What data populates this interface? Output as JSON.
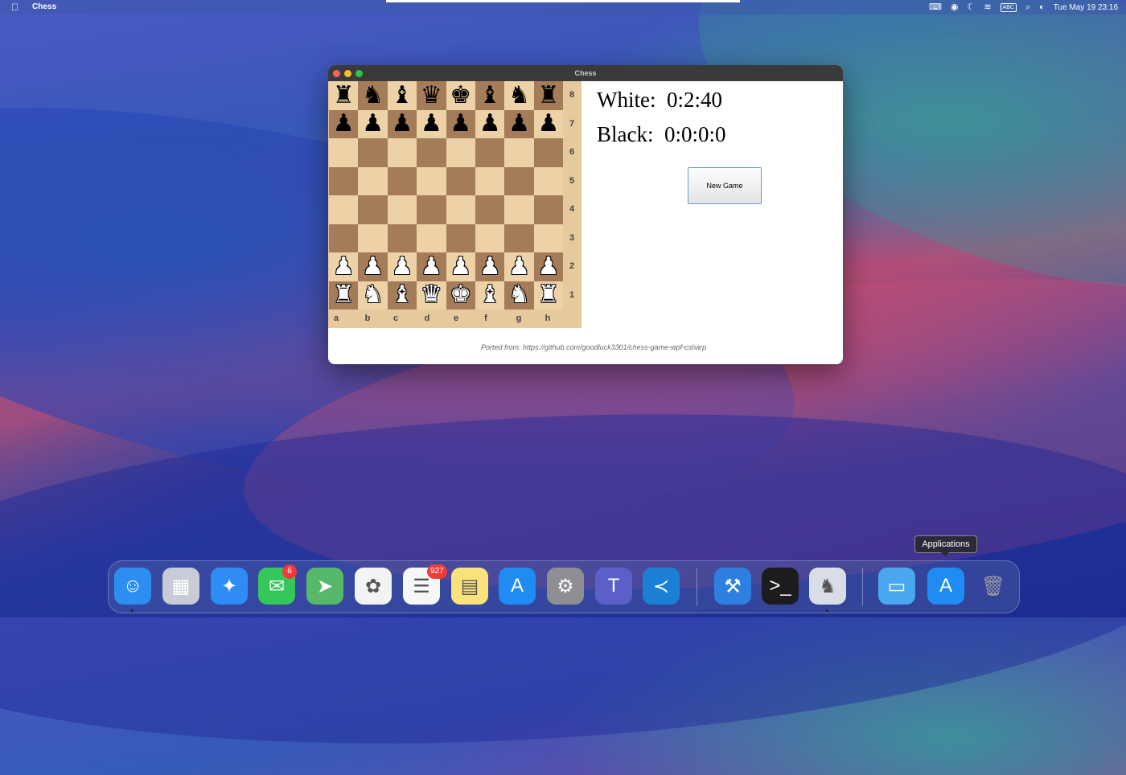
{
  "menubar": {
    "app_name": "Chess",
    "datetime": "Tue May 19  23:16",
    "status_icons": [
      "text-input-icon",
      "account-icon",
      "moon-icon",
      "wifi-icon",
      "keyboard-icon",
      "search-icon",
      "control-center-icon"
    ],
    "keyboard_label": "ABC"
  },
  "window": {
    "title": "Chess",
    "board": {
      "ranks": [
        "8",
        "7",
        "6",
        "5",
        "4",
        "3",
        "2",
        "1"
      ],
      "files": [
        "a",
        "b",
        "c",
        "d",
        "e",
        "f",
        "g",
        "h"
      ],
      "rows": [
        [
          "r",
          "n",
          "b",
          "q",
          "k",
          "b",
          "n",
          "r"
        ],
        [
          "p",
          "p",
          "p",
          "p",
          "p",
          "p",
          "p",
          "p"
        ],
        [
          "",
          "",
          "",
          "",
          "",
          "",
          "",
          ""
        ],
        [
          "",
          "",
          "",
          "",
          "",
          "",
          "",
          ""
        ],
        [
          "",
          "",
          "",
          "",
          "",
          "",
          "",
          ""
        ],
        [
          "",
          "",
          "",
          "",
          "",
          "",
          "",
          ""
        ],
        [
          "P",
          "P",
          "P",
          "P",
          "P",
          "P",
          "P",
          "P"
        ],
        [
          "R",
          "N",
          "B",
          "Q",
          "K",
          "B",
          "N",
          "R"
        ]
      ],
      "light_color": "#ecd2a6",
      "dark_color": "#a57c59"
    },
    "clocks": {
      "white_label": "White:",
      "white_time": "0:2:40",
      "black_label": "Black:",
      "black_time": "0:0:0:0"
    },
    "new_game_label": "New Game",
    "footer": "Ported from: https://github.com/goodluck3301/chess-game-wpf-csharp"
  },
  "dock": {
    "tooltip": "Applications",
    "items": [
      {
        "name": "finder",
        "color": "#2b8ef0",
        "glyph": "☺",
        "running": true
      },
      {
        "name": "launchpad",
        "color": "#c9ccd6",
        "glyph": "▦",
        "running": false
      },
      {
        "name": "safari",
        "color": "#2f8cf5",
        "glyph": "✦",
        "running": false
      },
      {
        "name": "messages",
        "color": "#35c759",
        "glyph": "✉",
        "running": false,
        "badge": "6"
      },
      {
        "name": "maps",
        "color": "#57b86a",
        "glyph": "➤",
        "running": false
      },
      {
        "name": "photos",
        "color": "#f3f3f3",
        "glyph": "✿",
        "running": false
      },
      {
        "name": "reminders",
        "color": "#f7f7f7",
        "glyph": "☰",
        "running": false,
        "badge": "927"
      },
      {
        "name": "notes",
        "color": "#fbe27a",
        "glyph": "▤",
        "running": false
      },
      {
        "name": "app-store",
        "color": "#1f8bf3",
        "glyph": "A",
        "running": false
      },
      {
        "name": "system-settings",
        "color": "#8e8e93",
        "glyph": "⚙",
        "running": false
      },
      {
        "name": "teams",
        "color": "#5b5fc7",
        "glyph": "T",
        "running": false
      },
      {
        "name": "vscode",
        "color": "#1b7fd4",
        "glyph": "≺",
        "running": false
      },
      {
        "name": "xcode",
        "color": "#2d7fe0",
        "glyph": "⚒",
        "running": false
      },
      {
        "name": "terminal",
        "color": "#1c1c1e",
        "glyph": ">_",
        "running": false
      },
      {
        "name": "chess",
        "color": "#d8dde6",
        "glyph": "♞",
        "running": true
      },
      {
        "name": "applications-folder",
        "color": "#4aa8f0",
        "glyph": "▭",
        "running": false
      },
      {
        "name": "app-store-2",
        "color": "#1f8bf3",
        "glyph": "A",
        "running": false
      },
      {
        "name": "trash",
        "color": "#9a9aa0",
        "glyph": "🗑",
        "running": false
      }
    ]
  }
}
